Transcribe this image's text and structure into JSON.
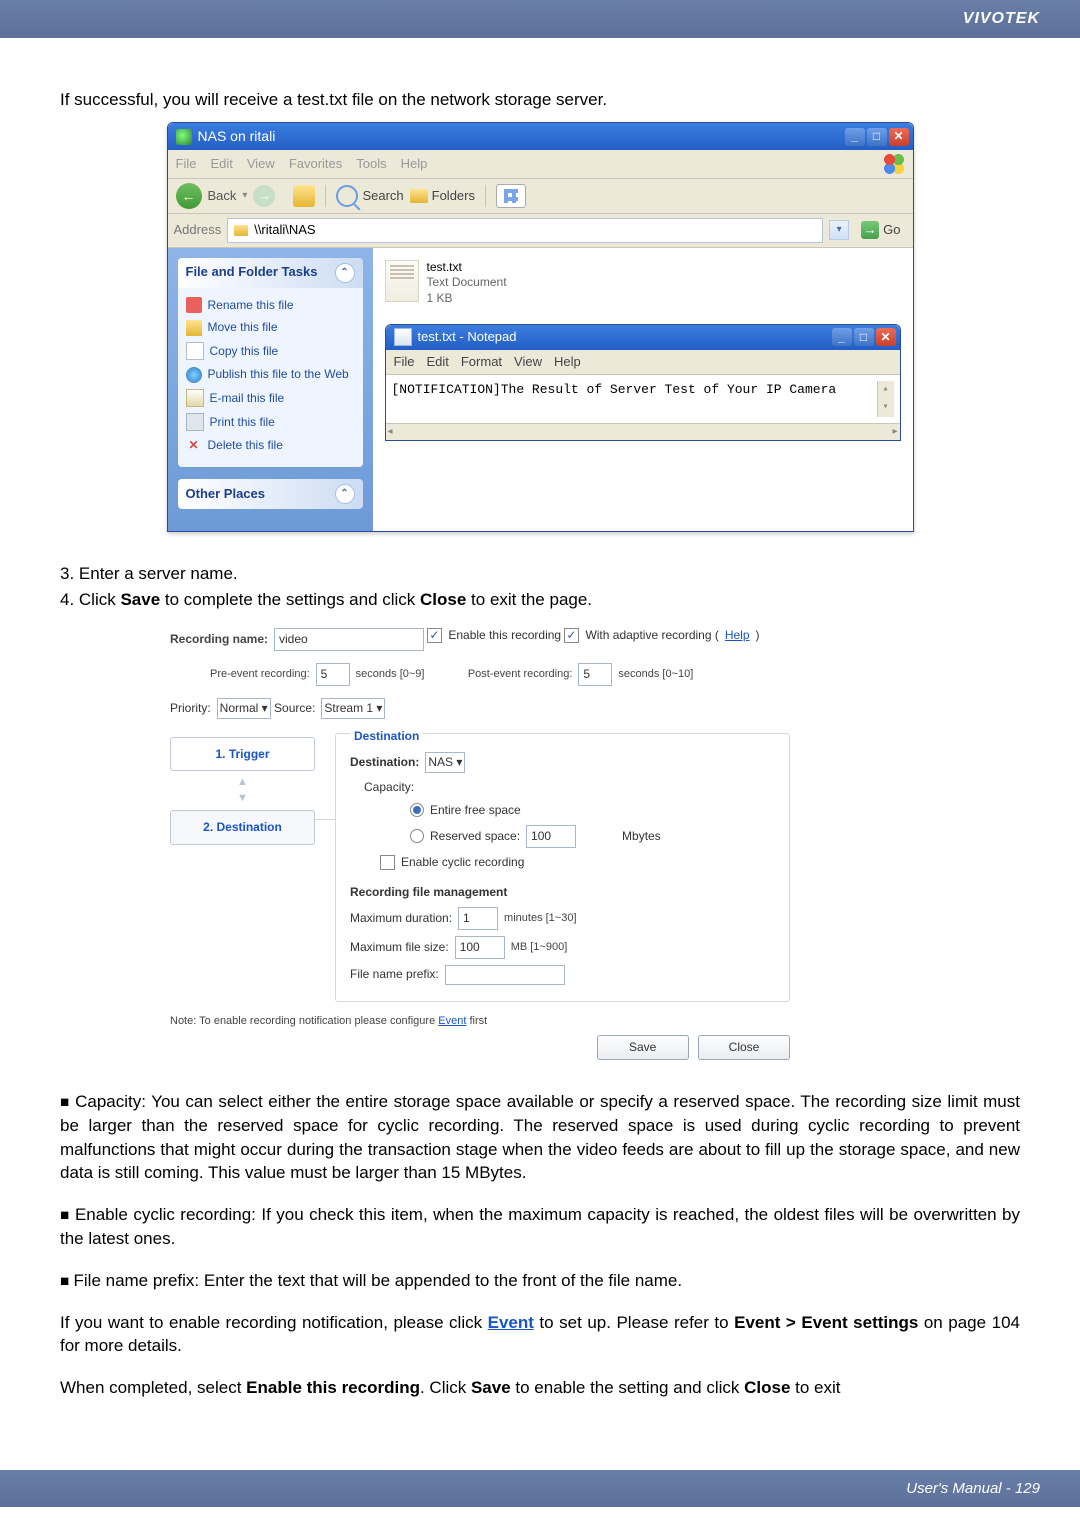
{
  "brand": "VIVOTEK",
  "intro": "If successful, you will receive a test.txt file on the network storage server.",
  "explorer": {
    "title": "NAS on ritali",
    "menu": [
      "File",
      "Edit",
      "View",
      "Favorites",
      "Tools",
      "Help"
    ],
    "toolbar": {
      "back": "Back",
      "search": "Search",
      "folders": "Folders"
    },
    "address_label": "Address",
    "address_value": "\\\\ritali\\NAS",
    "go": "Go",
    "tasks_header": "File and Folder Tasks",
    "tasks": [
      "Rename this file",
      "Move this file",
      "Copy this file",
      "Publish this file to the Web",
      "E-mail this file",
      "Print this file",
      "Delete this file"
    ],
    "other_places": "Other Places",
    "file": {
      "name": "test.txt",
      "type": "Text Document",
      "size": "1 KB"
    },
    "notepad": {
      "title": "test.txt - Notepad",
      "menu": [
        "File",
        "Edit",
        "Format",
        "View",
        "Help"
      ],
      "body": "[NOTIFICATION]The Result of Server Test of Your IP Camera"
    }
  },
  "steps": {
    "s3": "3. Enter a server name.",
    "s4_a": "4. Click ",
    "s4_b": "Save",
    "s4_c": " to complete the settings and click ",
    "s4_d": "Close",
    "s4_e": " to exit the page."
  },
  "form": {
    "recording_name_label": "Recording name:",
    "recording_name_value": "video",
    "enable_recording": "Enable this recording",
    "adaptive": "With adaptive recording (",
    "help": "Help",
    "adaptive_end": ")",
    "pre_label": "Pre-event recording:",
    "pre_value": "5",
    "pre_suffix": "seconds [0~9]",
    "post_label": "Post-event recording:",
    "post_value": "5",
    "post_suffix": "seconds [0~10]",
    "priority_label": "Priority:",
    "priority_value": "Normal",
    "source_label": "Source:",
    "source_value": "Stream 1",
    "step1": "1.  Trigger",
    "step2": "2.  Destination",
    "dest_fieldset": "Destination",
    "dest_label": "Destination:",
    "dest_value": "NAS",
    "capacity": "Capacity:",
    "entire": "Entire free space",
    "reserved": "Reserved space:",
    "reserved_value": "100",
    "reserved_unit": "Mbytes",
    "cyclic": "Enable cyclic recording",
    "rfm": "Recording file management",
    "max_dur": "Maximum duration:",
    "max_dur_value": "1",
    "max_dur_suffix": "minutes [1~30]",
    "max_size": "Maximum file size:",
    "max_size_value": "100",
    "max_size_suffix": "MB [1~900]",
    "prefix": "File name prefix:",
    "prefix_value": "",
    "note_a": "Note: To enable recording notification please configure ",
    "note_link": "Event",
    "note_b": " first",
    "save": "Save",
    "close": "Close"
  },
  "bullets": {
    "b1": "Capacity: You can select either the entire storage space available or specify a reserved space. The recording size limit must be larger than the reserved space for cyclic recording. The reserved space is used during cyclic recording to prevent malfunctions that might occur during the transaction stage when the video feeds are about to fill up the storage space, and new data is still coming. This value must be larger than 15 MBytes.",
    "b2": "Enable cyclic recording: If you check this item, when the maximum capacity is reached, the oldest files will be overwritten by the latest ones.",
    "b3": "File name prefix: Enter the text that will be appended to the front of the file name.",
    "p2_a": "If you want to enable recording notification, please click ",
    "p2_link": "Event",
    "p2_b": " to set up. Please refer to ",
    "p2_bold": "Event > Event settings",
    "p2_c": " on page 104 for more details.",
    "p3_a": "When completed, select ",
    "p3_b": "Enable this recording",
    "p3_c": ". Click ",
    "p3_d": "Save",
    "p3_e": " to enable the setting and click ",
    "p3_f": "Close",
    "p3_g": " to exit"
  },
  "footer": {
    "label": "User's Manual - ",
    "page": "129"
  }
}
